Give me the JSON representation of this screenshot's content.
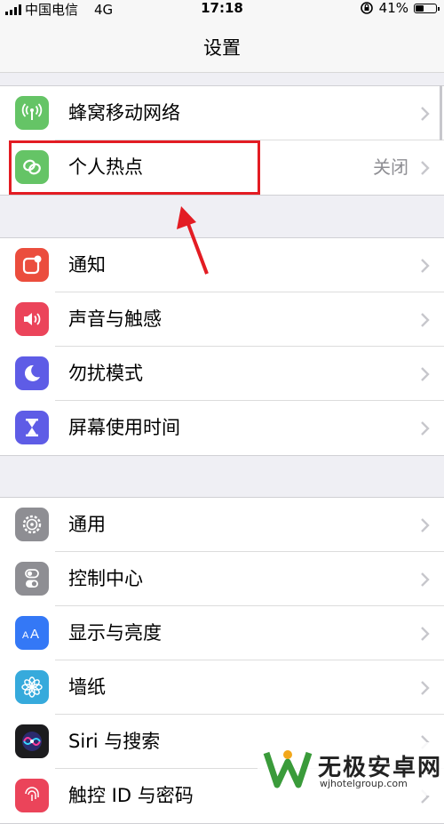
{
  "status_bar": {
    "carrier": "中国电信",
    "network": "4G",
    "time": "17:18",
    "battery": "41%",
    "battery_level": 0.41
  },
  "nav": {
    "title": "设置"
  },
  "groups": [
    {
      "items": [
        {
          "label": "蜂窝移动网络",
          "icon": "cellular-antenna-icon",
          "icon_color": "#65c466"
        },
        {
          "label": "个人热点",
          "value": "关闭",
          "icon": "hotspot-chain-icon",
          "icon_color": "#65c466"
        }
      ]
    },
    {
      "items": [
        {
          "label": "通知",
          "icon": "notification-icon",
          "icon_color": "#eb4d3d"
        },
        {
          "label": "声音与触感",
          "icon": "speaker-icon",
          "icon_color": "#eb445a"
        },
        {
          "label": "勿扰模式",
          "icon": "moon-icon",
          "icon_color": "#5e5ce6"
        },
        {
          "label": "屏幕使用时间",
          "icon": "hourglass-icon",
          "icon_color": "#5e5ce6"
        }
      ]
    },
    {
      "items": [
        {
          "label": "通用",
          "icon": "gear-icon",
          "icon_color": "#8e8e93"
        },
        {
          "label": "控制中心",
          "icon": "toggles-icon",
          "icon_color": "#8e8e93"
        },
        {
          "label": "显示与亮度",
          "icon": "text-size-icon",
          "icon_color": "#3478f6"
        },
        {
          "label": "墙纸",
          "icon": "flower-icon",
          "icon_color": "#36aadc"
        },
        {
          "label": "Siri 与搜索",
          "icon": "siri-icon",
          "icon_color": "#1c1c1e"
        },
        {
          "label": "触控 ID 与密码",
          "icon": "fingerprint-icon",
          "icon_color": "#eb445a"
        }
      ]
    }
  ],
  "annotation": {
    "highlight_color": "#e31c23"
  },
  "watermark": {
    "name": "无极安卓网",
    "url": "wjhotelgroup.com"
  }
}
